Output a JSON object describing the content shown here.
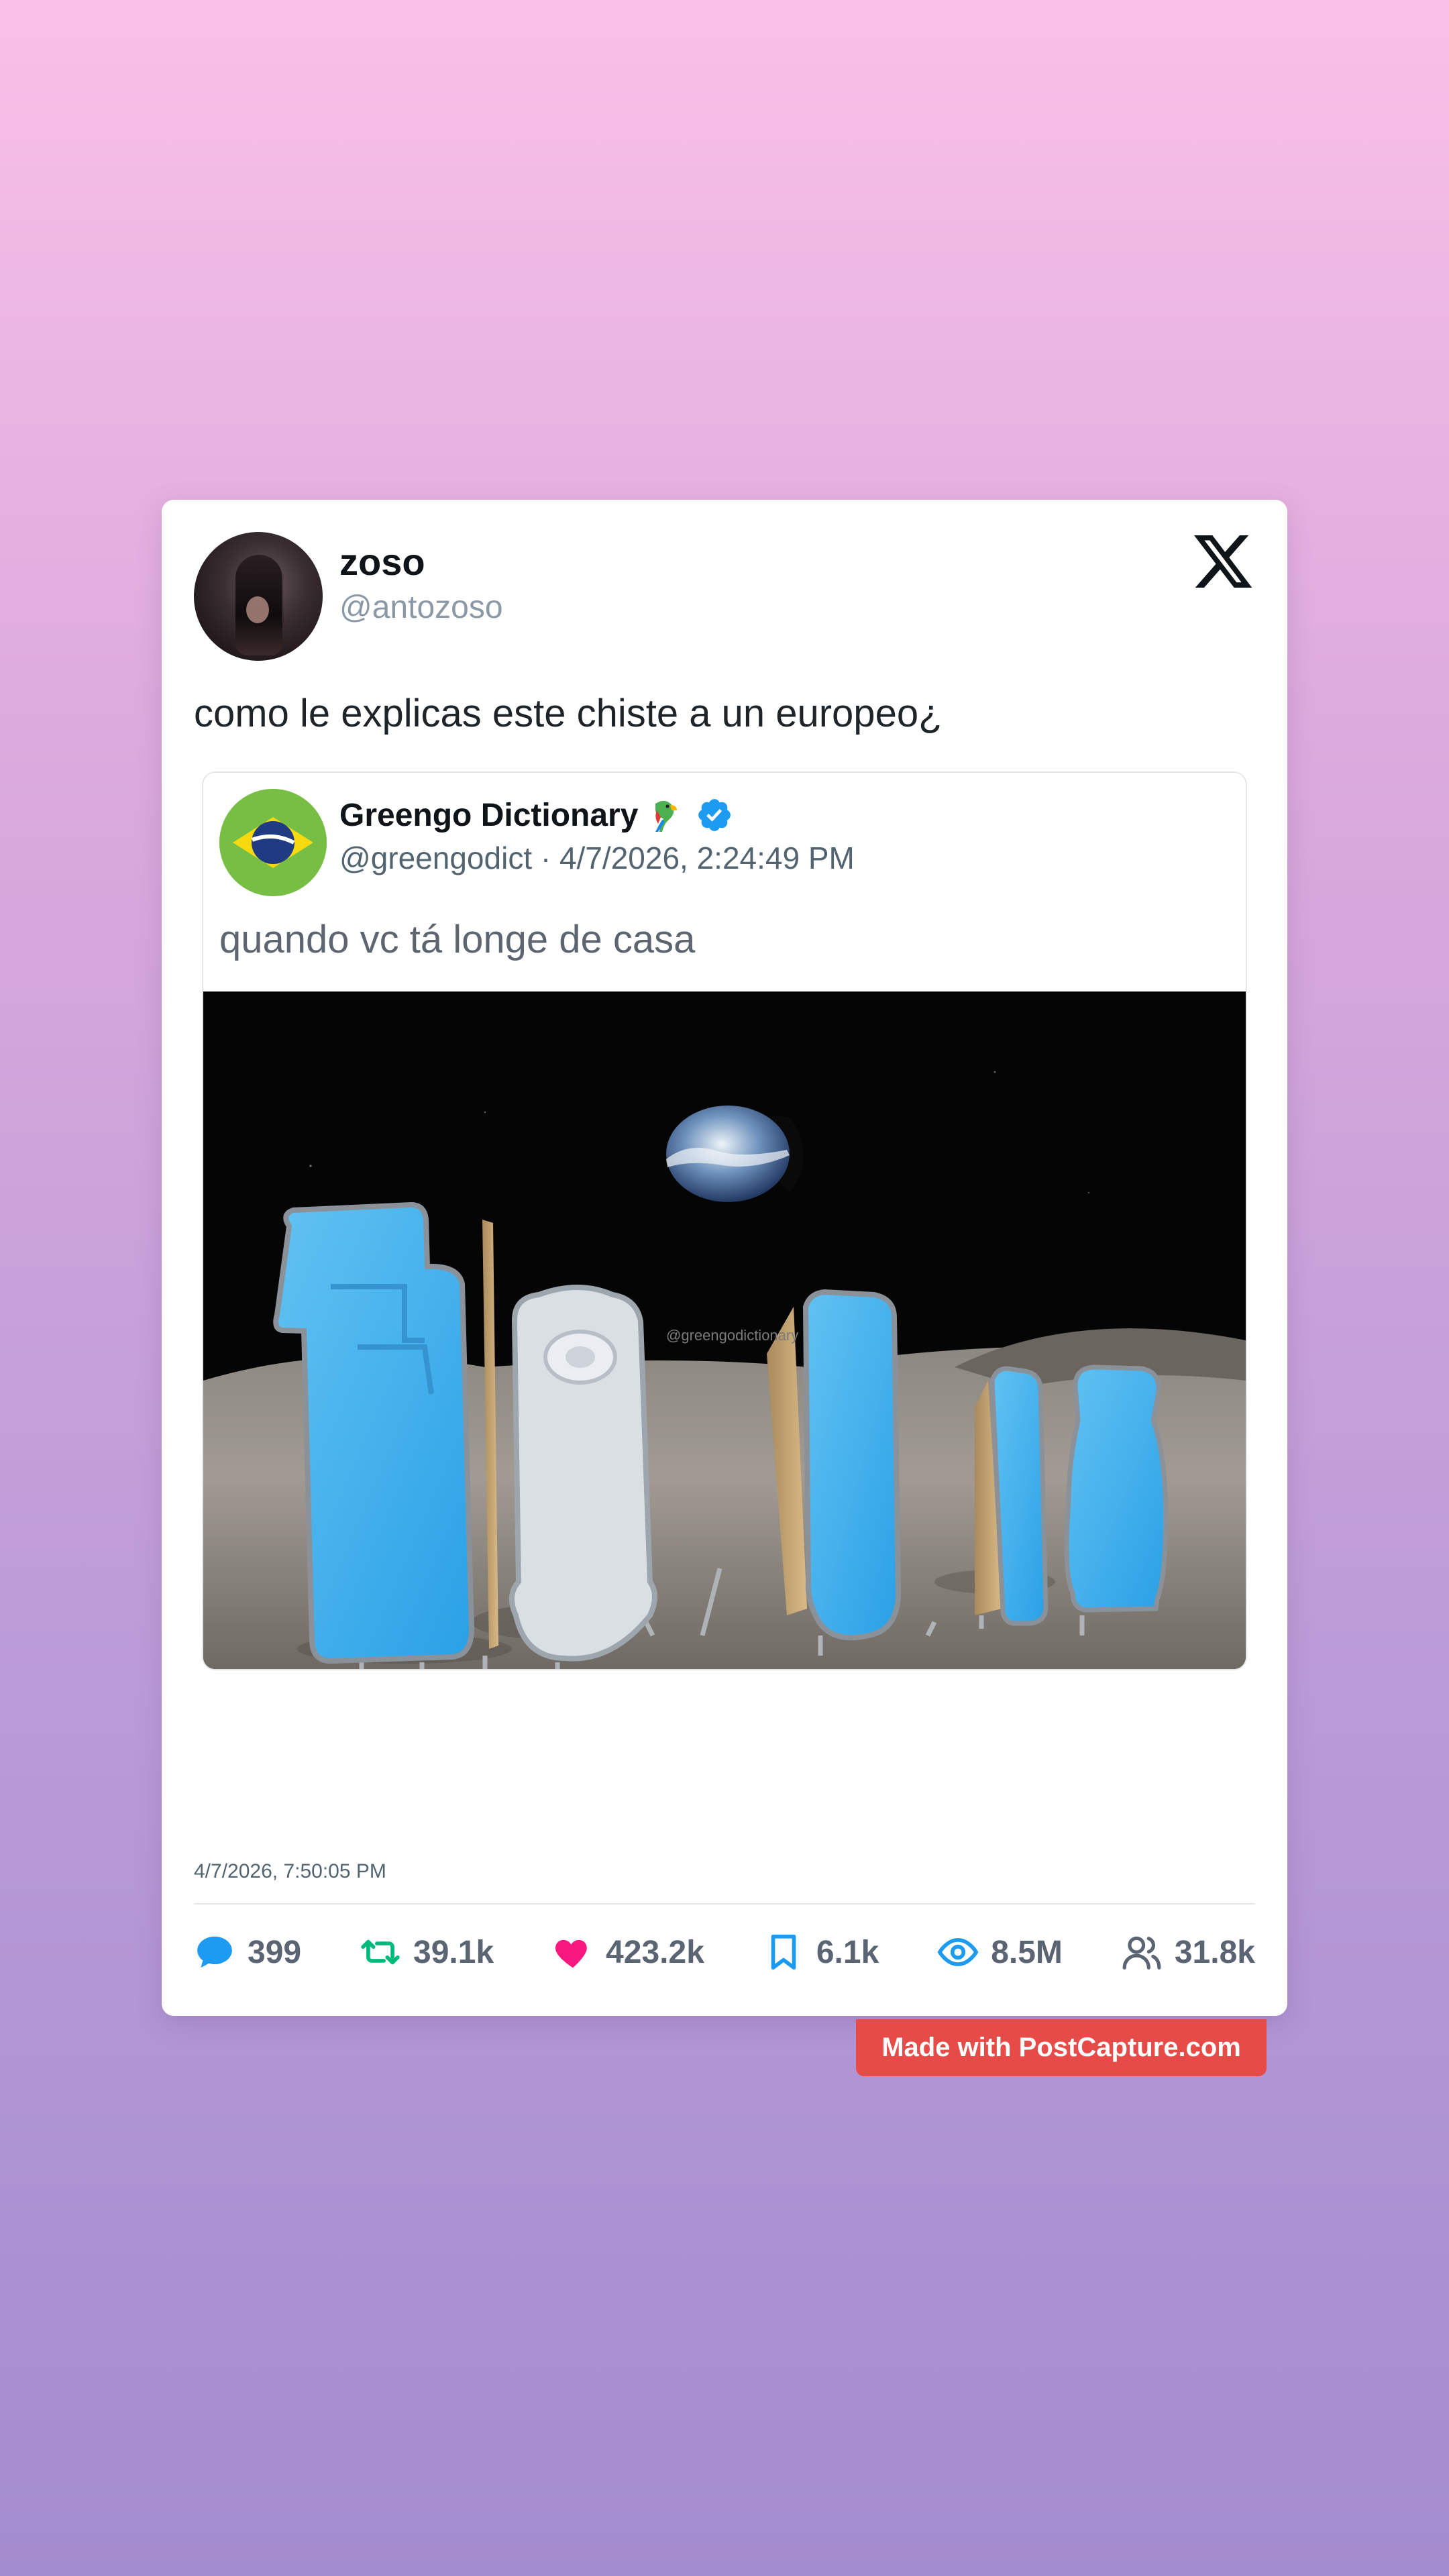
{
  "post": {
    "author_name": "zoso",
    "author_handle": "@antozoso",
    "text": "como le explicas este chiste a un europeo¿",
    "timestamp": "4/7/2026, 7:50:05 PM"
  },
  "quoted": {
    "author_name": "Greengo Dictionary",
    "emoji_icon": "parrot-icon",
    "verified": true,
    "meta": "@greengodict · 4/7/2026, 2:24:49 PM",
    "text": "quando vc tá longe de casa",
    "image_watermark": "@greengodictionary"
  },
  "stats": {
    "replies": "399",
    "reposts": "39.1k",
    "likes": "423.2k",
    "bookmarks": "6.1k",
    "views": "8.5M",
    "followers": "31.8k"
  },
  "colors": {
    "reply": "#1d9bf0",
    "repost": "#00ba7c",
    "like": "#f91880",
    "bookmark": "#1d9bf0",
    "views": "#1d9bf0",
    "followers": "#5a6472",
    "badge": "#e74b47"
  },
  "badge": {
    "label": "Made with PostCapture.com"
  }
}
